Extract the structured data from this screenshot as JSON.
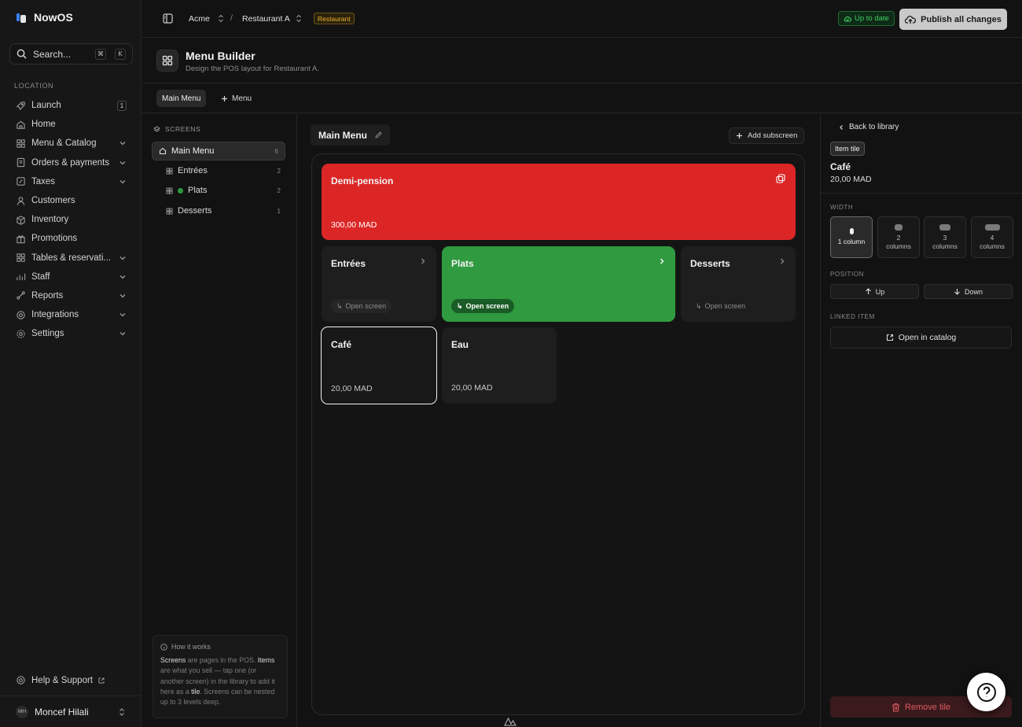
{
  "app": {
    "name": "NowOS"
  },
  "search": {
    "placeholder": "Search...",
    "kbd1": "⌘",
    "kbd2": "K"
  },
  "sidebar": {
    "section": "LOCATION",
    "items": [
      {
        "label": "Launch",
        "icon": "rocket-icon",
        "badge": "1",
        "expandable": false
      },
      {
        "label": "Home",
        "icon": "home-icon",
        "expandable": false
      },
      {
        "label": "Menu & Catalog",
        "icon": "grid-icon",
        "expandable": true
      },
      {
        "label": "Orders & payments",
        "icon": "receipt-icon",
        "expandable": true
      },
      {
        "label": "Taxes",
        "icon": "percent-icon",
        "expandable": true
      },
      {
        "label": "Customers",
        "icon": "users-icon",
        "expandable": false
      },
      {
        "label": "Inventory",
        "icon": "box-icon",
        "expandable": false
      },
      {
        "label": "Promotions",
        "icon": "gift-icon",
        "expandable": false
      },
      {
        "label": "Tables & reservati...",
        "icon": "table-icon",
        "expandable": true
      },
      {
        "label": "Staff",
        "icon": "staff-icon",
        "expandable": true
      },
      {
        "label": "Reports",
        "icon": "chart-icon",
        "expandable": true
      },
      {
        "label": "Integrations",
        "icon": "plug-icon",
        "expandable": true
      },
      {
        "label": "Settings",
        "icon": "gear-icon",
        "expandable": true
      }
    ],
    "help": "Help & Support",
    "user": {
      "initials": "MH",
      "name": "Moncef Hilali"
    }
  },
  "topbar": {
    "org": "Acme",
    "separator": "/",
    "location": "Restaurant A",
    "location_tag": "Restaurant",
    "status": "Up to date",
    "publish": "Publish all changes"
  },
  "page": {
    "title": "Menu Builder",
    "subtitle": "Design the POS layout for Restaurant A."
  },
  "tabs": {
    "active": "Main Menu",
    "add": "Menu"
  },
  "screens": {
    "label": "SCREENS",
    "main": {
      "label": "Main Menu",
      "count": "6"
    },
    "children": [
      {
        "label": "Entrées",
        "count": "2",
        "dot": false
      },
      {
        "label": "Plats",
        "count": "2",
        "dot": true
      },
      {
        "label": "Desserts",
        "count": "1",
        "dot": false
      }
    ],
    "howto": {
      "title": "How it works",
      "screens": "Screens",
      "t1": " are pages in the POS. ",
      "items": "Items",
      "t2": " are what you sell — tap one (or another screen) in the library to add it here as a ",
      "tile": "tile",
      "t3": ". Screens can be nested up to 3 levels deep."
    }
  },
  "canvas": {
    "title": "Main Menu",
    "add_subscreen": "Add subscreen",
    "open_screen": "Open screen",
    "colors": {
      "red": "#dc2626",
      "green": "#2f9a3f"
    },
    "tiles": {
      "demi": {
        "title": "Demi-pension",
        "price": "300,00 MAD"
      },
      "entrees": {
        "title": "Entrées"
      },
      "plats": {
        "title": "Plats"
      },
      "desserts": {
        "title": "Desserts"
      },
      "cafe": {
        "title": "Café",
        "price": "20,00 MAD"
      },
      "eau": {
        "title": "Eau",
        "price": "20,00 MAD"
      }
    }
  },
  "panel": {
    "back": "Back to library",
    "tag": "Item tile",
    "name": "Café",
    "price": "20,00 MAD",
    "width_label": "WIDTH",
    "widths": [
      {
        "l1": "1 column",
        "l2": ""
      },
      {
        "l1": "2",
        "l2": "columns"
      },
      {
        "l1": "3",
        "l2": "columns"
      },
      {
        "l1": "4",
        "l2": "columns"
      }
    ],
    "selected_width": 1,
    "position_label": "POSITION",
    "up": "Up",
    "down": "Down",
    "linked_label": "LINKED ITEM",
    "open_catalog": "Open in catalog",
    "remove": "Remove tile"
  }
}
